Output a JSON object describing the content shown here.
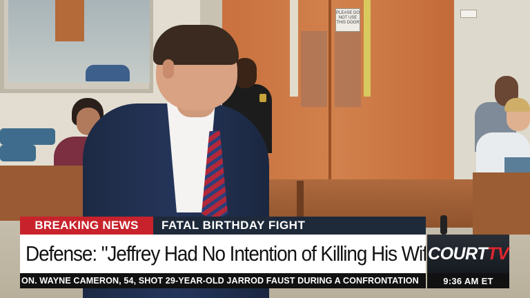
{
  "lower_third": {
    "breaking_label": "BREAKING NEWS",
    "slug": "FATAL BIRTHDAY FIGHT",
    "headline": "Defense: \"Jeffrey Had No Intention of Killing His Wife\"",
    "ticker": "ON. WAYNE CAMERON, 54, SHOT 29-YEAR-OLD JARROD FAUST DURING A CONFRONTATION"
  },
  "brand": {
    "name_main": "COURT",
    "name_suffix": "TV",
    "time": "9:36 AM ET"
  },
  "scene": {
    "door_sign": "PLEASE DO NOT USE THIS DOOR"
  },
  "colors": {
    "breaking_red": "#c8232c",
    "slug_navy": "#1e2a3a",
    "brand_red": "#e0262f"
  }
}
